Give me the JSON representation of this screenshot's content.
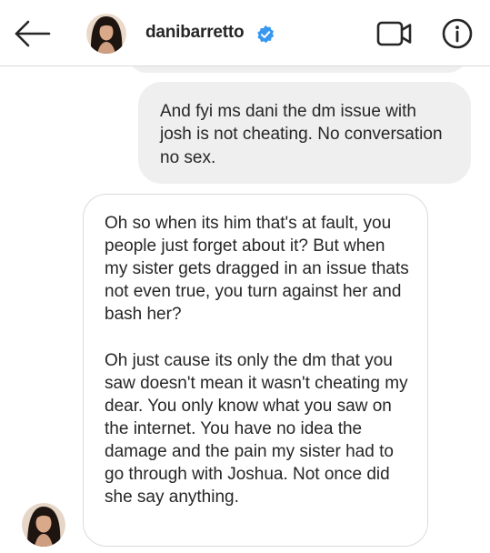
{
  "header": {
    "username": "danibarretto",
    "verified_icon": "verified-badge-icon",
    "back_icon": "arrow-left-icon",
    "video_icon": "video-camera-icon",
    "info_icon": "info-icon"
  },
  "messages": [
    {
      "sender": "me",
      "text": "And fyi ms dani the dm issue with josh is not cheating. No conversation no sex."
    },
    {
      "sender": "danibarretto",
      "text": "Oh so when its him that's at fault, you people just forget about it? But when my sister gets dragged in an issue thats not even true, you turn against her and bash her?\n\nOh just cause its only the dm that you saw doesn't mean it wasn't cheating my dear. You only know what you saw on the internet. You have no idea the damage and the pain my sister had to go through with Joshua. Not once did she say anything."
    }
  ],
  "colors": {
    "accent_verified": "#3897f0",
    "sent_bubble": "#efefef",
    "received_border": "#dbdbdb",
    "text": "#262626"
  }
}
